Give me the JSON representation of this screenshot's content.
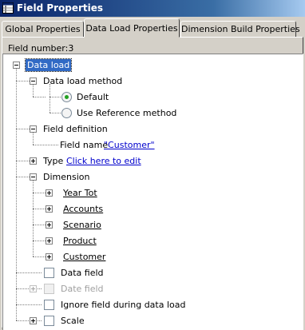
{
  "window": {
    "title": "Field Properties",
    "title_icon": "properties-grid-icon"
  },
  "tabs": [
    {
      "label": "Global Properties",
      "active": false
    },
    {
      "label": "Data Load Properties",
      "active": true
    },
    {
      "label": "Dimension Build Properties",
      "active": false
    }
  ],
  "field_number_label": "Field number:3",
  "tree": {
    "root_label": "Data load",
    "load_method": {
      "label": "Data load method",
      "options": [
        {
          "label": "Default",
          "selected": true
        },
        {
          "label": "Use Reference method",
          "selected": false
        }
      ]
    },
    "field_definition": {
      "label": "Field definition",
      "field_name_label": "Field name",
      "field_name_value": "\"Customer\""
    },
    "type": {
      "label": "Type",
      "link": "Click here to edit"
    },
    "dimension": {
      "label": "Dimension",
      "items": [
        "Year Tot",
        "Accounts",
        "Scenario",
        "Product",
        "Customer"
      ]
    },
    "data_field": {
      "label": "Data field",
      "checked": false
    },
    "date_field": {
      "label": "Date field",
      "checked": false,
      "disabled": true
    },
    "ignore_field": {
      "label": "Ignore field during data load",
      "checked": false
    },
    "scale": {
      "label": "Scale",
      "checked": false
    }
  }
}
